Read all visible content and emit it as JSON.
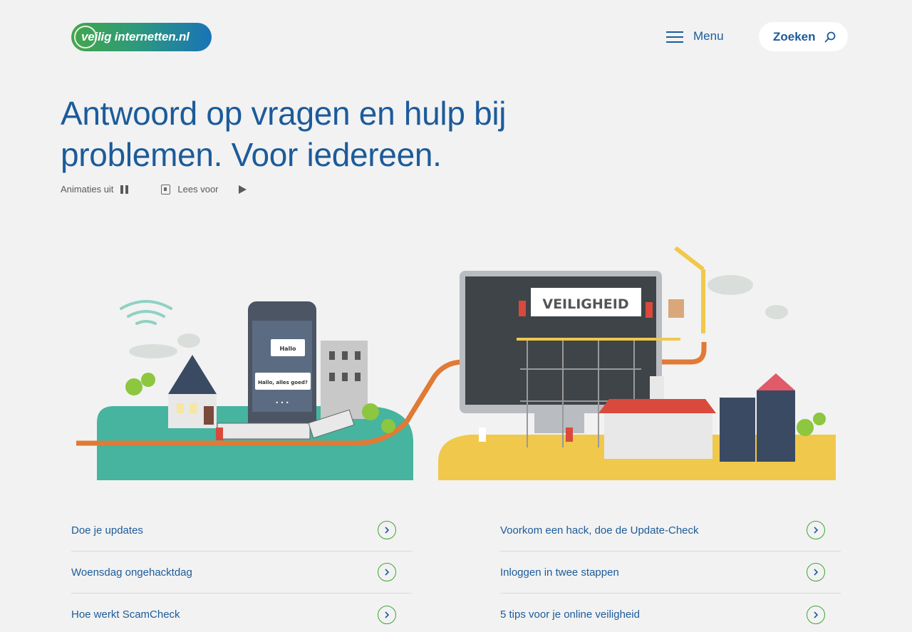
{
  "header": {
    "logo_text": "veilig internetten.nl",
    "menu_label": "Menu",
    "search_label": "Zoeken"
  },
  "hero": {
    "title_line1": "Antwoord op vragen en hulp bij",
    "title_line2": "problemen. Voor iedereen.",
    "animations_label": "Animaties uit",
    "read_aloud_label": "Lees voor"
  },
  "illustration": {
    "speech_bubble_1": "Hallo",
    "speech_bubble_2": "Hallo, alles goed?",
    "typing": "• • •",
    "banner": "VEILIGHEID"
  },
  "links": [
    {
      "label": "Doe je updates"
    },
    {
      "label": "Voorkom een hack, doe de Update-Check"
    },
    {
      "label": "Woensdag ongehacktdag"
    },
    {
      "label": "Inloggen in twee stappen"
    },
    {
      "label": "Hoe werkt ScamCheck"
    },
    {
      "label": "5 tips voor je online veiligheid"
    }
  ],
  "colors": {
    "primary_blue": "#1c5b9a",
    "accent_green": "#3fa535",
    "teal": "#46b49e",
    "yellow": "#f0c84b",
    "orange": "#e07a35"
  }
}
